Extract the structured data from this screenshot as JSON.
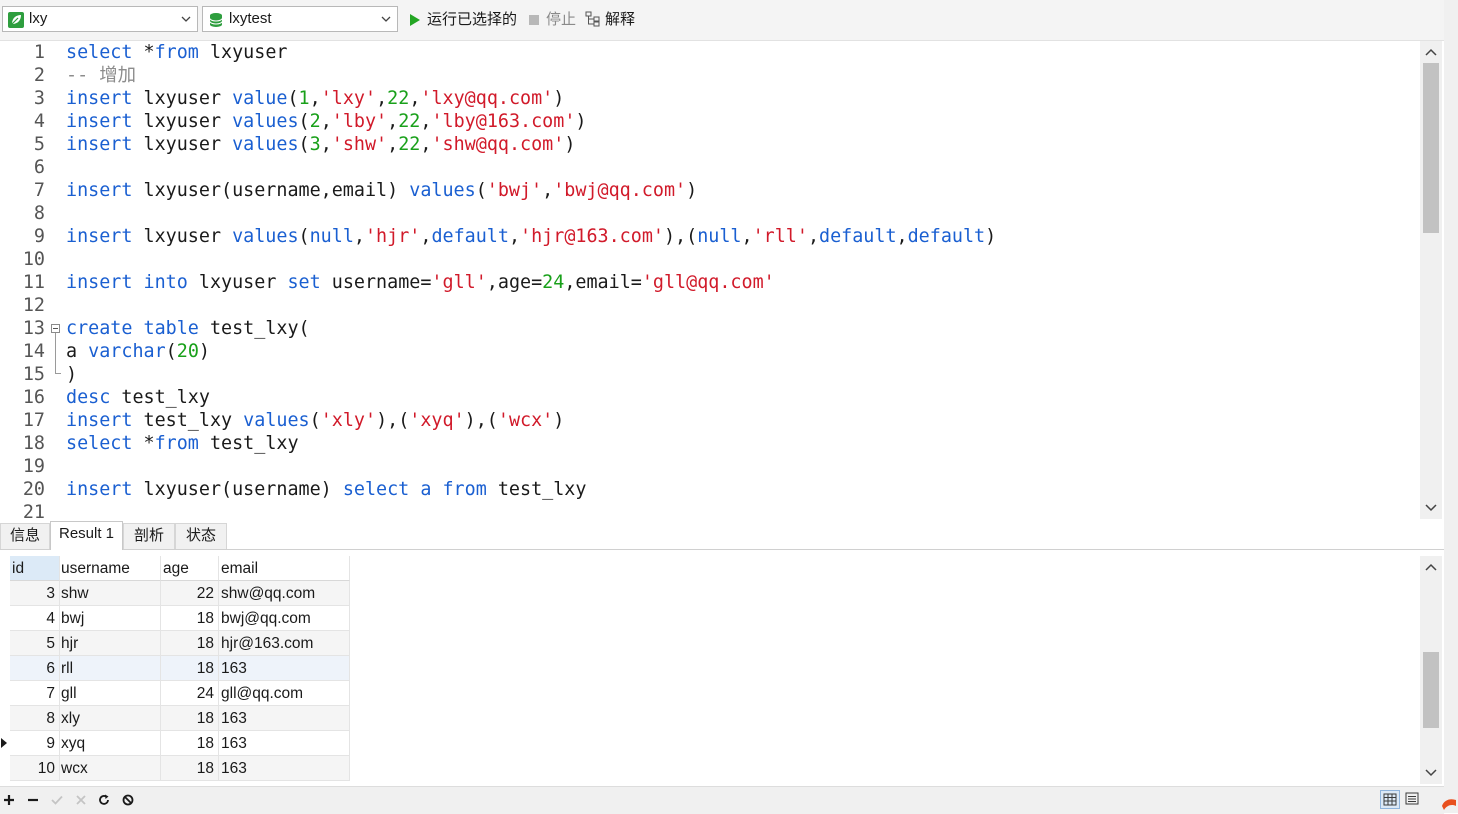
{
  "toolbar": {
    "connection": "lxy",
    "database": "lxytest",
    "run_selected_label": "运行已选择的",
    "stop_label": "停止",
    "explain_label": "解释",
    "icons": {
      "connection": "connection-leaf-icon",
      "database": "database-icon",
      "run": "play-icon",
      "stop": "stop-icon",
      "explain": "explain-icon"
    }
  },
  "editor": {
    "lines": [
      {
        "n": "1",
        "tokens": [
          [
            "kw",
            "select"
          ],
          [
            "t",
            " *"
          ],
          [
            "kw",
            "from"
          ],
          [
            "t",
            " lxyuser"
          ]
        ]
      },
      {
        "n": "2",
        "tokens": [
          [
            "cmt",
            "-- 增加"
          ]
        ]
      },
      {
        "n": "3",
        "tokens": [
          [
            "kw",
            "insert"
          ],
          [
            "t",
            " lxyuser "
          ],
          [
            "kw",
            "value"
          ],
          [
            "t",
            "("
          ],
          [
            "num",
            "1"
          ],
          [
            "t",
            ","
          ],
          [
            "str",
            "'lxy'"
          ],
          [
            "t",
            ","
          ],
          [
            "num",
            "22"
          ],
          [
            "t",
            ","
          ],
          [
            "str",
            "'lxy@qq.com'"
          ],
          [
            "t",
            ")"
          ]
        ]
      },
      {
        "n": "4",
        "tokens": [
          [
            "kw",
            "insert"
          ],
          [
            "t",
            " lxyuser "
          ],
          [
            "kw",
            "values"
          ],
          [
            "t",
            "("
          ],
          [
            "num",
            "2"
          ],
          [
            "t",
            ","
          ],
          [
            "str",
            "'lby'"
          ],
          [
            "t",
            ","
          ],
          [
            "num",
            "22"
          ],
          [
            "t",
            ","
          ],
          [
            "str",
            "'lby@163.com'"
          ],
          [
            "t",
            ")"
          ]
        ]
      },
      {
        "n": "5",
        "tokens": [
          [
            "kw",
            "insert"
          ],
          [
            "t",
            " lxyuser "
          ],
          [
            "kw",
            "values"
          ],
          [
            "t",
            "("
          ],
          [
            "num",
            "3"
          ],
          [
            "t",
            ","
          ],
          [
            "str",
            "'shw'"
          ],
          [
            "t",
            ","
          ],
          [
            "num",
            "22"
          ],
          [
            "t",
            ","
          ],
          [
            "str",
            "'shw@qq.com'"
          ],
          [
            "t",
            ")"
          ]
        ]
      },
      {
        "n": "6",
        "tokens": []
      },
      {
        "n": "7",
        "tokens": [
          [
            "kw",
            "insert"
          ],
          [
            "t",
            " lxyuser(username,email) "
          ],
          [
            "kw",
            "values"
          ],
          [
            "t",
            "("
          ],
          [
            "str",
            "'bwj'"
          ],
          [
            "t",
            ","
          ],
          [
            "str",
            "'bwj@qq.com'"
          ],
          [
            "t",
            ")"
          ]
        ]
      },
      {
        "n": "8",
        "tokens": []
      },
      {
        "n": "9",
        "tokens": [
          [
            "kw",
            "insert"
          ],
          [
            "t",
            " lxyuser "
          ],
          [
            "kw",
            "values"
          ],
          [
            "t",
            "("
          ],
          [
            "kw",
            "null"
          ],
          [
            "t",
            ","
          ],
          [
            "str",
            "'hjr'"
          ],
          [
            "t",
            ","
          ],
          [
            "kw",
            "default"
          ],
          [
            "t",
            ","
          ],
          [
            "str",
            "'hjr@163.com'"
          ],
          [
            "t",
            "),("
          ],
          [
            "kw",
            "null"
          ],
          [
            "t",
            ","
          ],
          [
            "str",
            "'rll'"
          ],
          [
            "t",
            ","
          ],
          [
            "kw",
            "default"
          ],
          [
            "t",
            ","
          ],
          [
            "kw",
            "default"
          ],
          [
            "t",
            ")"
          ]
        ]
      },
      {
        "n": "10",
        "tokens": []
      },
      {
        "n": "11",
        "tokens": [
          [
            "kw",
            "insert"
          ],
          [
            "t",
            " "
          ],
          [
            "kw",
            "into"
          ],
          [
            "t",
            " lxyuser "
          ],
          [
            "kw",
            "set"
          ],
          [
            "t",
            " username="
          ],
          [
            "str",
            "'gll'"
          ],
          [
            "t",
            ",age="
          ],
          [
            "num",
            "24"
          ],
          [
            "t",
            ",email="
          ],
          [
            "str",
            "'gll@qq.com'"
          ]
        ]
      },
      {
        "n": "12",
        "tokens": []
      },
      {
        "n": "13",
        "tokens": [
          [
            "kw",
            "create"
          ],
          [
            "t",
            " "
          ],
          [
            "kw",
            "table"
          ],
          [
            "t",
            " test_lxy("
          ]
        ]
      },
      {
        "n": "14",
        "tokens": [
          [
            "t",
            "a "
          ],
          [
            "kw",
            "varchar"
          ],
          [
            "t",
            "("
          ],
          [
            "num",
            "20"
          ],
          [
            "t",
            ")"
          ]
        ]
      },
      {
        "n": "15",
        "tokens": [
          [
            "t",
            ")"
          ]
        ]
      },
      {
        "n": "16",
        "tokens": [
          [
            "kw",
            "desc"
          ],
          [
            "t",
            " test_lxy"
          ]
        ]
      },
      {
        "n": "17",
        "tokens": [
          [
            "kw",
            "insert"
          ],
          [
            "t",
            " test_lxy "
          ],
          [
            "kw",
            "values"
          ],
          [
            "t",
            "("
          ],
          [
            "str",
            "'xly'"
          ],
          [
            "t",
            "),("
          ],
          [
            "str",
            "'xyq'"
          ],
          [
            "t",
            "),("
          ],
          [
            "str",
            "'wcx'"
          ],
          [
            "t",
            ")"
          ]
        ]
      },
      {
        "n": "18",
        "tokens": [
          [
            "kw",
            "select"
          ],
          [
            "t",
            " *"
          ],
          [
            "kw",
            "from"
          ],
          [
            "t",
            " test_lxy"
          ]
        ]
      },
      {
        "n": "19",
        "tokens": []
      },
      {
        "n": "20",
        "tokens": [
          [
            "kw",
            "insert"
          ],
          [
            "t",
            " lxyuser(username) "
          ],
          [
            "kw",
            "select"
          ],
          [
            "t",
            " "
          ],
          [
            "kw",
            "a"
          ],
          [
            "t",
            " "
          ],
          [
            "kw",
            "from"
          ],
          [
            "t",
            " test_lxy"
          ]
        ]
      },
      {
        "n": "21",
        "tokens": []
      }
    ]
  },
  "tabs": [
    {
      "label": "信息",
      "active": false
    },
    {
      "label": "Result 1",
      "active": true
    },
    {
      "label": "剖析",
      "active": false
    },
    {
      "label": "状态",
      "active": false
    }
  ],
  "grid": {
    "columns": [
      "id",
      "username",
      "age",
      "email"
    ],
    "rows": [
      [
        "3",
        "shw",
        "22",
        "shw@qq.com"
      ],
      [
        "4",
        "bwj",
        "18",
        "bwj@qq.com"
      ],
      [
        "5",
        "hjr",
        "18",
        "hjr@163.com"
      ],
      [
        "6",
        "rll",
        "18",
        "163"
      ],
      [
        "7",
        "gll",
        "24",
        "gll@qq.com"
      ],
      [
        "8",
        "xly",
        "18",
        "163"
      ],
      [
        "9",
        "xyq",
        "18",
        "163"
      ],
      [
        "10",
        "wcx",
        "18",
        "163"
      ]
    ]
  },
  "bottombar": {
    "icons": [
      "add-row-icon",
      "delete-row-icon",
      "apply-check-icon",
      "cancel-x-icon",
      "refresh-icon",
      "stop-circle-icon"
    ],
    "views": [
      "grid-view-icon",
      "form-view-icon"
    ]
  },
  "colors": {
    "keyword": "#1a5fd1",
    "string": "#d11a2a",
    "number": "#19a01a",
    "comment": "#8c8c8c"
  }
}
